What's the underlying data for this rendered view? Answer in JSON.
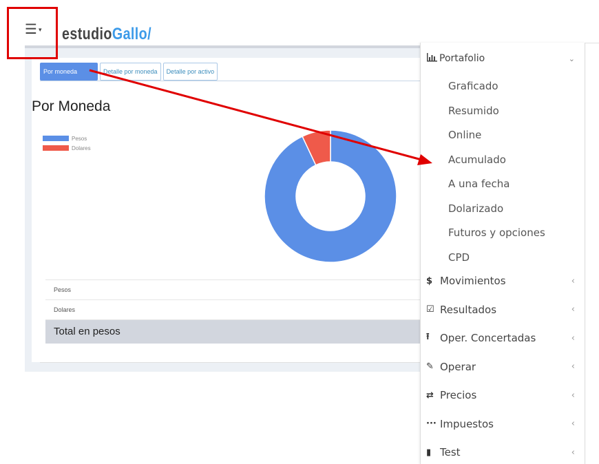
{
  "header": {
    "logo_part1": "estudio",
    "logo_part2": "Gallo",
    "logo_slash": "/"
  },
  "tabs": [
    {
      "label": "Por moneda",
      "active": true
    },
    {
      "label": "Detalle por moneda",
      "active": false
    },
    {
      "label": "Detalle por activo",
      "active": false
    }
  ],
  "main": {
    "title": "Por Moneda",
    "legend": [
      {
        "label": "Pesos",
        "color": "#5b8fe6"
      },
      {
        "label": "Dolares",
        "color": "#ef5a4a"
      }
    ],
    "rows": [
      {
        "label": "Pesos"
      },
      {
        "label": "Dolares"
      }
    ],
    "total_label": "Total en pesos"
  },
  "chart_data": {
    "type": "pie",
    "donut": true,
    "categories": [
      "Pesos",
      "Dolares"
    ],
    "values": [
      0.93,
      0.07
    ],
    "colors": [
      "#5b8fe6",
      "#ef5a4a"
    ]
  },
  "menu": {
    "head": {
      "label": "Portafolio",
      "icon": "bar-chart-icon"
    },
    "sub_items": [
      "Graficado",
      "Resumido",
      "Online",
      "Acumulado",
      "A una fecha",
      "Dolarizado",
      "Futuros y opciones",
      "CPD"
    ],
    "items": [
      {
        "label": "Movimientos",
        "icon": "$",
        "icon_name": "dollar-icon"
      },
      {
        "label": "Resultados",
        "icon": "☑",
        "icon_name": "check-square-icon"
      },
      {
        "label": "Oper. Concertadas",
        "icon": "⭱",
        "icon_name": "upload-icon"
      },
      {
        "label": "Operar",
        "icon": "✎",
        "icon_name": "edit-icon"
      },
      {
        "label": "Precios",
        "icon": "⇄",
        "icon_name": "exchange-icon"
      },
      {
        "label": "Impuestos",
        "icon": "···",
        "icon_name": "ellipsis-icon"
      },
      {
        "label": "Test",
        "icon": "▮",
        "icon_name": "chess-icon"
      }
    ]
  },
  "colors": {
    "accent": "#3c8dbc",
    "annotation": "#e00000"
  }
}
